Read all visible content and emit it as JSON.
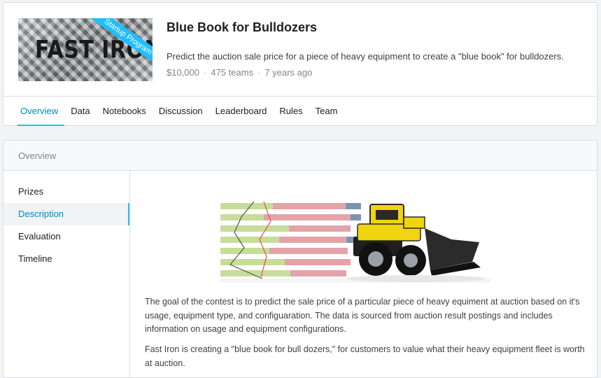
{
  "competition": {
    "banner_text": "FAST IRON",
    "banner_ribbon": "Startup Program",
    "title": "Blue Book for Bulldozers",
    "description": "Predict the auction sale price for a piece of heavy equipment to create a \"blue book\" for bulldozers.",
    "prize": "$10,000",
    "teams": "475 teams",
    "age": "7 years ago"
  },
  "tabs": [
    {
      "label": "Overview",
      "active": true
    },
    {
      "label": "Data"
    },
    {
      "label": "Notebooks"
    },
    {
      "label": "Discussion"
    },
    {
      "label": "Leaderboard"
    },
    {
      "label": "Rules"
    },
    {
      "label": "Team"
    }
  ],
  "overview": {
    "header": "Overview",
    "sidebar": [
      {
        "label": "Prizes"
      },
      {
        "label": "Description",
        "active": true
      },
      {
        "label": "Evaluation"
      },
      {
        "label": "Timeline"
      }
    ],
    "paragraphs": [
      "The goal of the contest is to predict the sale price of a particular piece of heavy equiment at auction based on it's usage, equipment type, and configuaration.  The data is sourced from auction result postings and includes information on usage and equipment configurations.",
      "Fast Iron is creating a \"blue book for bull dozers,\" for customers to value what their heavy equipment fleet is worth at auction."
    ]
  },
  "colors": {
    "accent": "#20beff",
    "accent_text": "#008abc",
    "bar_green": "#c7dd9a",
    "bar_red": "#e3a4a9",
    "bar_blue": "#7e95b0",
    "bulldozer_yellow": "#f0d40f"
  }
}
